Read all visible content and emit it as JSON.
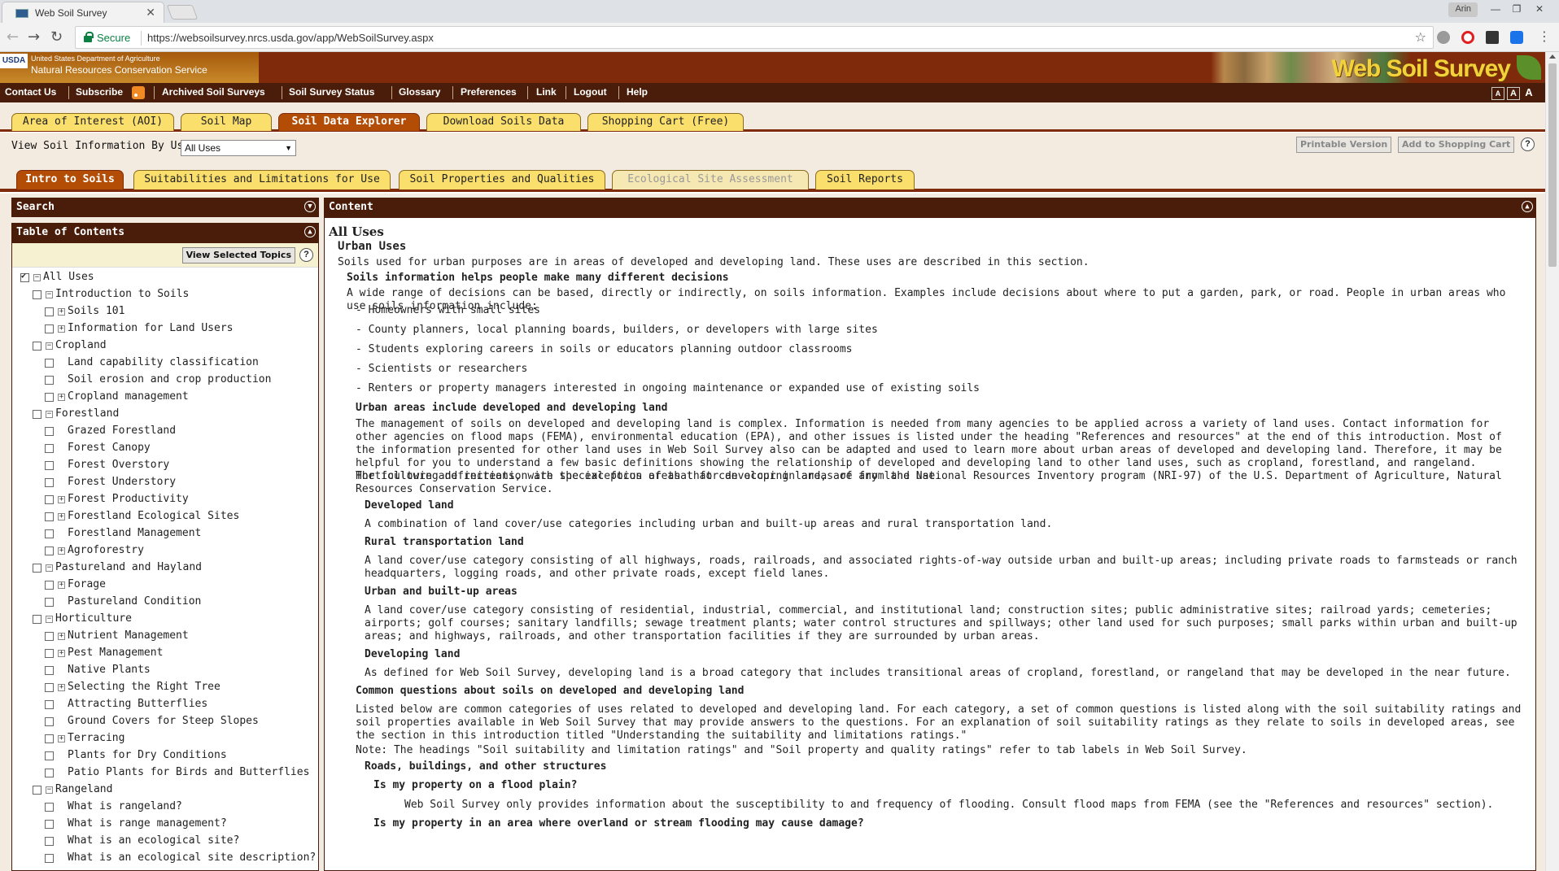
{
  "browser": {
    "tab_title": "Web Soil Survey",
    "tab_close": "✕",
    "user": "Arin",
    "secure_label": "Secure",
    "url": "https://websoilsurvey.nrcs.usda.gov/app/WebSoilSurvey.aspx",
    "nav": {
      "back": "←",
      "forward": "→",
      "reload": "↻"
    },
    "star": "☆",
    "window": {
      "minimize": "—",
      "restore": "❐",
      "close": "✕"
    },
    "menu": "⋮"
  },
  "header": {
    "usda_mark": "USDA",
    "dept_text": "United States Department of Agriculture",
    "agency": "Natural Resources Conservation Service",
    "logo_title": "Web Soil Survey"
  },
  "topnav": {
    "items": [
      "Contact Us",
      "Subscribe",
      "Archived Soil Surveys",
      "Soil Survey Status",
      "Glossary",
      "Preferences",
      "Link",
      "Logout",
      "Help"
    ],
    "text_sizes": [
      "A",
      "A",
      "A"
    ]
  },
  "main_tabs": [
    "Area of Interest (AOI)",
    "Soil Map",
    "Soil Data Explorer",
    "Download Soils Data",
    "Shopping Cart (Free)"
  ],
  "toolbar": {
    "view_label": "View Soil Information By Use:",
    "view_value": "All Uses",
    "printable": "Printable Version",
    "add_cart": "Add to Shopping Cart",
    "help": "?"
  },
  "sub_tabs": [
    "Intro to Soils",
    "Suitabilities and Limitations for Use",
    "Soil Properties and Qualities",
    "Ecological Site Assessment",
    "Soil Reports"
  ],
  "left_panel": {
    "search_title": "Search",
    "toc_title": "Table of Contents",
    "view_selected": "View Selected Topics",
    "items": [
      {
        "label": "All Uses"
      },
      {
        "label": "Introduction to Soils"
      },
      {
        "label": "Soils 101"
      },
      {
        "label": "Information for Land Users"
      },
      {
        "label": "Cropland"
      },
      {
        "label": "Land capability classification"
      },
      {
        "label": "Soil erosion and crop production"
      },
      {
        "label": "Cropland management"
      },
      {
        "label": "Forestland"
      },
      {
        "label": "Grazed Forestland"
      },
      {
        "label": "Forest Canopy"
      },
      {
        "label": "Forest Overstory"
      },
      {
        "label": "Forest Understory"
      },
      {
        "label": "Forest Productivity"
      },
      {
        "label": "Forestland Ecological Sites"
      },
      {
        "label": "Forestland Management"
      },
      {
        "label": "Agroforestry"
      },
      {
        "label": "Pastureland and Hayland"
      },
      {
        "label": "Forage"
      },
      {
        "label": "Pastureland Condition"
      },
      {
        "label": "Horticulture"
      },
      {
        "label": "Nutrient Management"
      },
      {
        "label": "Pest Management"
      },
      {
        "label": "Native Plants"
      },
      {
        "label": "Selecting the Right Tree"
      },
      {
        "label": "Attracting Butterflies"
      },
      {
        "label": "Ground Covers for Steep Slopes"
      },
      {
        "label": "Terracing"
      },
      {
        "label": "Plants for Dry Conditions"
      },
      {
        "label": "Patio Plants for Birds and Butterflies"
      },
      {
        "label": "Rangeland"
      },
      {
        "label": "What is rangeland?"
      },
      {
        "label": "What is range management?"
      },
      {
        "label": "What is an ecological site?"
      },
      {
        "label": "What is an ecological site description?"
      }
    ]
  },
  "content": {
    "panel_title": "Content",
    "title": "All Uses",
    "urban_uses": "Urban Uses",
    "urban_intro": "Soils used for urban purposes are in areas of developed and developing land. These uses are described in this section.",
    "decisions_heading": "Soils information helps people make many different decisions",
    "decisions_text": "A wide range of decisions can be based, directly or indirectly, on soils information. Examples include decisions about where to put a garden, park, or road. People in urban areas who use soils information include:",
    "bullets": [
      "- Homeowners with small sites",
      "- County planners, local planning boards, builders, or developers with large sites",
      "- Students exploring careers in soils or educators planning outdoor classrooms",
      "- Scientists or researchers",
      "- Renters or property managers interested in ongoing maintenance or expanded use of existing soils"
    ],
    "urban_areas_heading": "Urban areas include developed and developing land",
    "urban_areas_text": "The management of soils on developed and developing land is complex. Information is needed from many agencies to be applied across a variety of land uses. Contact information for other agencies on flood maps (FEMA), environmental education (EPA), and other issues is listed under the heading \"References and resources\" at the end of this introduction. Most of the information presented for other land uses in Web Soil Survey also can be adapted and used to learn more about urban areas of developed and developing land. Therefore, it may be helpful for you to understand a few basic definitions showing the relationship of developed and developing land to other land uses, such as cropland, forestland, and rangeland. Horticulture and recreation are special focus areas that can occur in areas of any land use.",
    "definitions_text": "The following definitions, with the exception of that for developing land, are from the National Resources Inventory program (NRI-97) of the U.S. Department of Agriculture, Natural Resources Conservation Service.",
    "developed_heading": "Developed land",
    "developed_text": "A combination of land cover/use categories including urban and built-up areas and rural transportation land.",
    "rural_heading": "Rural transportation land",
    "rural_text": "A land cover/use category consisting of all highways, roads, railroads, and associated rights-of-way outside urban and built-up areas; including private roads to farmsteads or ranch headquarters, logging roads, and other private roads, except field lanes.",
    "builtup_heading": "Urban and built-up areas",
    "builtup_text": "A land cover/use category consisting of residential, industrial, commercial, and institutional land; construction sites; public administrative sites; railroad yards; cemeteries; airports; golf courses; sanitary landfills; sewage treatment plants; water control structures and spillways; other land used for such purposes; small parks within urban and built-up areas; and highways, railroads, and other transportation facilities if they are surrounded by urban areas.",
    "developing_heading": "Developing land",
    "developing_text": "As defined for Web Soil Survey, developing land is a broad category that includes transitional areas of cropland, forestland, or rangeland that may be developed in the near future.",
    "common_heading": "Common questions about soils on developed and developing land",
    "common_text": "Listed below are common categories of uses related to developed and developing land. For each category, a set of common questions is listed along with the soil suitability ratings and soil properties available in Web Soil Survey that may provide answers to the questions. For an explanation of soil suitability ratings as they relate to soils in developed areas, see the section in this introduction titled \"Understanding the suitability and limitations ratings.\"",
    "note_text": "Note: The headings \"Soil suitability and limitation ratings\" and \"Soil property and quality ratings\" refer to tab labels in Web Soil Survey.",
    "roads_heading": "Roads, buildings, and other structures",
    "flood_q": "Is my property on a flood plain?",
    "flood_a": "Web Soil Survey only provides information about the susceptibility to and frequency of flooding. Consult flood maps from FEMA (see the \"References and resources\" section).",
    "overland_q": "Is my property in an area where overland or stream flooding may cause damage?"
  }
}
